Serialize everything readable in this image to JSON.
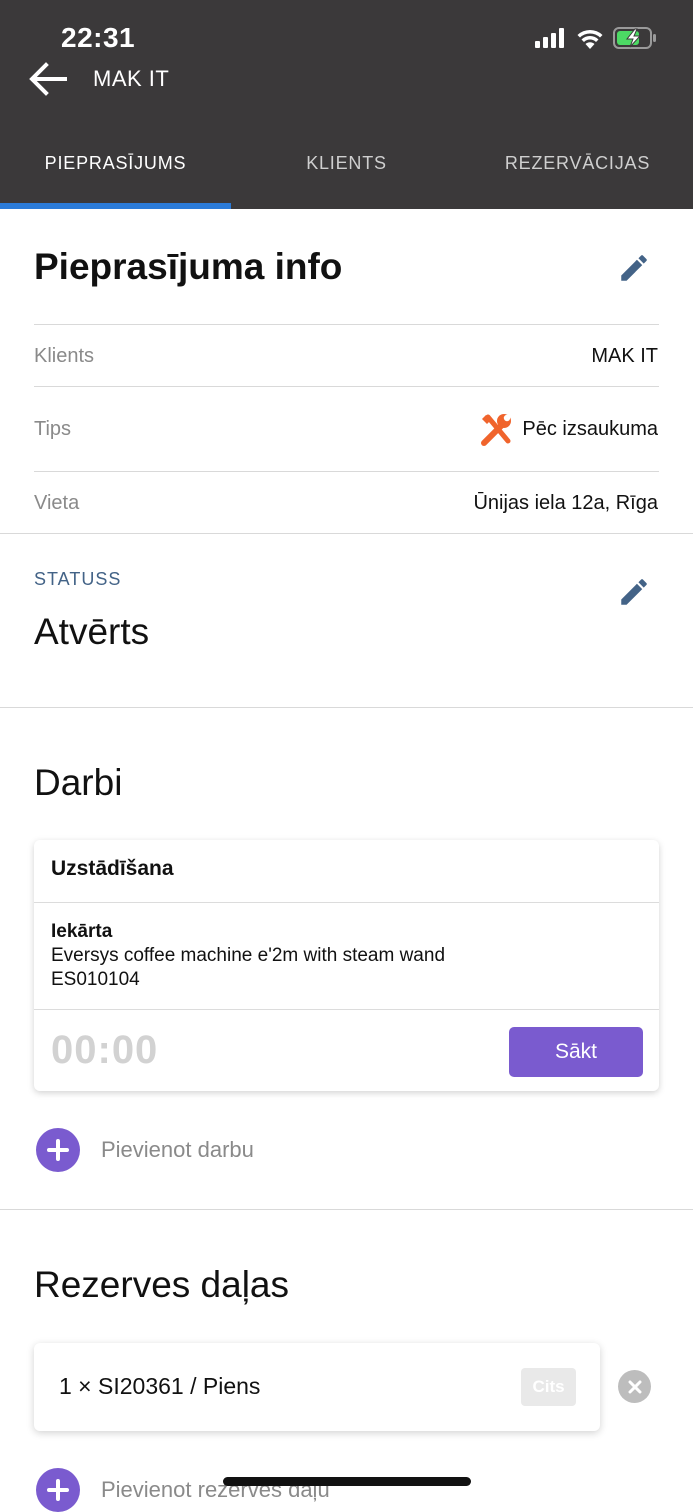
{
  "status_bar": {
    "time": "22:31"
  },
  "header": {
    "title": "MAK IT"
  },
  "tabs": [
    {
      "label": "PIEPRASĪJUMS",
      "active": true
    },
    {
      "label": "KLIENTS",
      "active": false
    },
    {
      "label": "REZERVĀCIJAS",
      "active": false
    }
  ],
  "info": {
    "title": "Pieprasījuma info",
    "rows": [
      {
        "label": "Klients",
        "value": "MAK IT"
      },
      {
        "label": "Tips",
        "value": "Pēc izsaukuma",
        "icon": "tools-icon"
      },
      {
        "label": "Vieta",
        "value": "Ūnijas iela 12a, Rīga"
      }
    ]
  },
  "status": {
    "caption": "STATUSS",
    "value": "Atvērts"
  },
  "works": {
    "title": "Darbi",
    "card": {
      "title": "Uzstādīšana",
      "equipment_label": "Iekārta",
      "equipment_name": "Eversys coffee machine e'2m with steam wand",
      "equipment_serial": "ES010104",
      "timer": "00:00",
      "start_label": "Sākt"
    },
    "add_label": "Pievienot darbu"
  },
  "parts": {
    "title": "Rezerves daļas",
    "items": [
      {
        "text": "1 × SI20361 / Piens",
        "badge": "Cits"
      }
    ],
    "add_label": "Pievienot rezerves daļu"
  },
  "colors": {
    "header_bg": "#3b393a",
    "tab_indicator": "#2b7bd8",
    "accent": "#7a5bcf",
    "edit_icon": "#436387",
    "tools_icon": "#f0642c"
  }
}
